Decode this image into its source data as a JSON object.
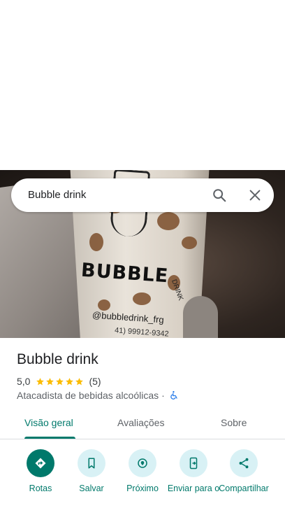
{
  "search": {
    "query": "Bubble drink"
  },
  "hero": {
    "cup_brand": "BUBBLE",
    "cup_sub": "DRINK",
    "cup_handle": "@bubbledrink_frg",
    "cup_phone": "41) 99912-9342"
  },
  "place": {
    "name": "Bubble drink",
    "rating": "5,0",
    "stars": 5,
    "review_count": "(5)",
    "category": "Atacadista de bebidas alcoólicas",
    "separator": "·"
  },
  "tabs": [
    {
      "label": "Visão geral",
      "active": true
    },
    {
      "label": "Avaliações",
      "active": false
    },
    {
      "label": "Sobre",
      "active": false
    }
  ],
  "actions": [
    {
      "label": "Rotas",
      "icon": "directions-icon"
    },
    {
      "label": "Salvar",
      "icon": "bookmark-icon"
    },
    {
      "label": "Próximo",
      "icon": "nearby-icon"
    },
    {
      "label": "Enviar para o",
      "icon": "send-to-phone-icon"
    },
    {
      "label": "Compartilhar",
      "icon": "share-icon"
    }
  ],
  "colors": {
    "accent": "#00796b",
    "chip": "#d8f1f5",
    "star": "#fbbc04",
    "text": "#202124",
    "muted": "#5f6368",
    "accessibility": "#1a73e8"
  }
}
